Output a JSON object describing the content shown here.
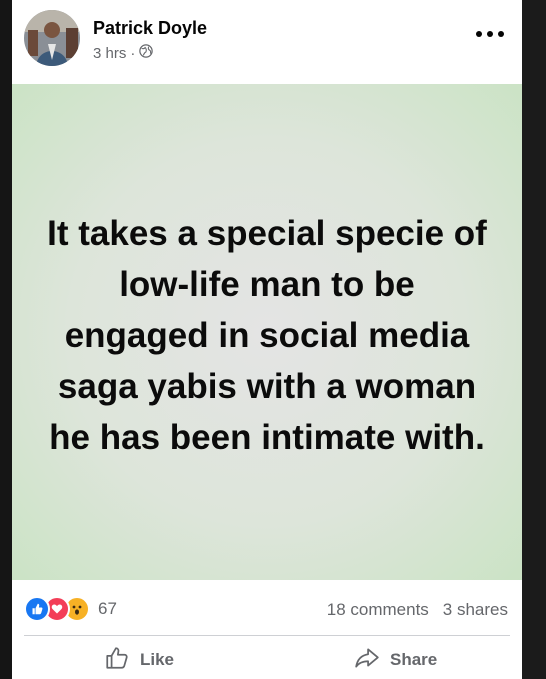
{
  "post": {
    "author": "Patrick Doyle",
    "time": "3 hrs",
    "separator": "·",
    "privacy_icon": "globe-icon",
    "text": "It takes a special specie of low-life man to be engaged in social media saga yabis with a woman he has been intimate with.",
    "background_colors": [
      "#e4e4e4",
      "#dde5da",
      "#cbe3c5"
    ]
  },
  "stats": {
    "reaction_icons": [
      "like-reaction-icon",
      "love-reaction-icon",
      "wow-reaction-icon"
    ],
    "reaction_count": "67",
    "comments": "18 comments",
    "shares": "3 shares"
  },
  "actions": {
    "like_label": "Like",
    "share_label": "Share"
  },
  "colors": {
    "like_blue": "#1877f2",
    "love_red": "#f33e58",
    "wow_yellow": "#f7b125",
    "muted_text": "#65676b"
  }
}
